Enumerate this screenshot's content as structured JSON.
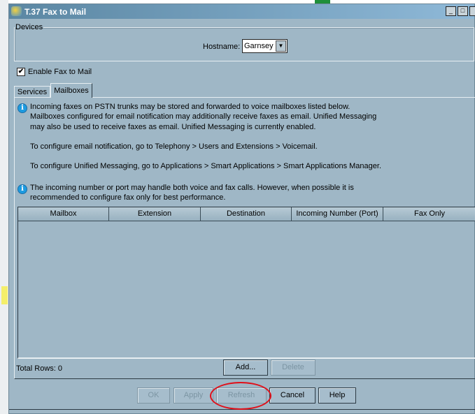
{
  "window": {
    "title": "T.37 Fax to Mail",
    "minimize": "_",
    "maximize": "□"
  },
  "devices": {
    "legend": "Devices",
    "hostname_label": "Hostname:",
    "hostname_value": "Garnsey"
  },
  "enable_checkbox": {
    "label": "Enable Fax to Mail",
    "checked": true
  },
  "tabs": [
    {
      "label": "Services",
      "active": false
    },
    {
      "label": "Mailboxes",
      "active": true
    }
  ],
  "info1": {
    "lines": [
      "Incoming faxes on PSTN trunks may be stored and forwarded to voice mailboxes listed below.",
      "Mailboxes configured for email notification may additionally receive faxes as email. Unified Messaging",
      "may also be used to receive faxes as email. Unified Messaging is currently enabled."
    ],
    "email_config": "To configure email notification, go to Telephony > Users and Extensions > Voicemail.",
    "um_config": "To configure Unified Messaging, go to Applications > Smart Applications > Smart Applications Manager."
  },
  "info2": {
    "lines": [
      "The incoming number or port may handle both voice and fax calls. However, when possible it is",
      "recommended to configure fax only for best performance."
    ]
  },
  "table": {
    "columns": [
      "Mailbox",
      "Extension",
      "Destination",
      "Incoming Number (Port)",
      "Fax Only"
    ],
    "rows": []
  },
  "total_rows": "Total Rows: 0",
  "buttons": {
    "add": "Add...",
    "delete": "Delete",
    "ok": "OK",
    "apply": "Apply",
    "refresh": "Refresh",
    "cancel": "Cancel",
    "help": "Help"
  },
  "colors": {
    "annotation": "#e0101a",
    "titlebar": "#5b87a3",
    "panel": "#9fb7c6"
  }
}
